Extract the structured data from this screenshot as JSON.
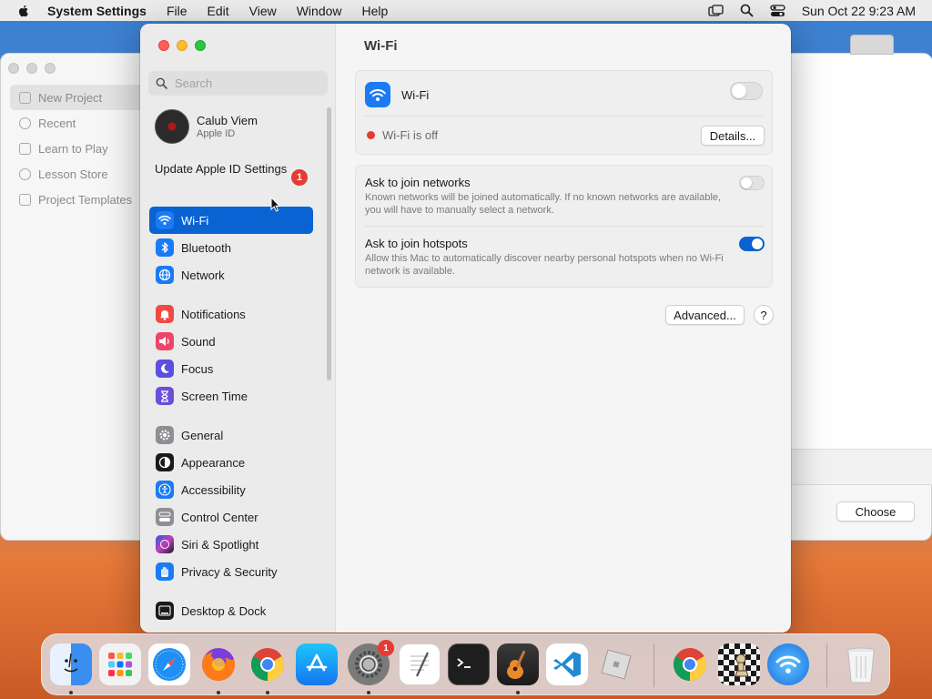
{
  "menubar": {
    "app_name": "System Settings",
    "menus": [
      "File",
      "Edit",
      "View",
      "Window",
      "Help"
    ],
    "clock": "Sun Oct 22  9:23 AM"
  },
  "background_app": {
    "sidebar_items": [
      "New Project",
      "Recent",
      "Learn to Play",
      "Lesson Store",
      "Project Templates"
    ],
    "choose_label": "Choose"
  },
  "settings": {
    "search": {
      "placeholder": "Search",
      "value": ""
    },
    "profile": {
      "name": "Calub Viem",
      "subtitle": "Apple ID"
    },
    "update": {
      "label": "Update Apple ID Settings",
      "badge": "1"
    },
    "nav": [
      {
        "label": "Wi-Fi",
        "icon": "wifi-icon",
        "color": "#1a7bf5",
        "active": true
      },
      {
        "label": "Bluetooth",
        "icon": "bluetooth-icon",
        "color": "#1a7bf5"
      },
      {
        "label": "Network",
        "icon": "globe-icon",
        "color": "#1a7bf5"
      },
      {
        "label": "Notifications",
        "icon": "bell-icon",
        "color": "#f04a45"
      },
      {
        "label": "Sound",
        "icon": "speaker-icon",
        "color": "#f0456a"
      },
      {
        "label": "Focus",
        "icon": "moon-icon",
        "color": "#5a4fe0"
      },
      {
        "label": "Screen Time",
        "icon": "hourglass-icon",
        "color": "#6a4fd8"
      },
      {
        "label": "General",
        "icon": "gear-icon",
        "color": "#8e8e93"
      },
      {
        "label": "Appearance",
        "icon": "appearance-icon",
        "color": "#1a1a1a"
      },
      {
        "label": "Accessibility",
        "icon": "accessibility-icon",
        "color": "#1a7bf5"
      },
      {
        "label": "Control Center",
        "icon": "control-center-icon",
        "color": "#8e8e93"
      },
      {
        "label": "Siri & Spotlight",
        "icon": "siri-icon",
        "color": "#c23fb8"
      },
      {
        "label": "Privacy & Security",
        "icon": "hand-icon",
        "color": "#1a7bf5"
      },
      {
        "label": "Desktop & Dock",
        "icon": "dock-icon",
        "color": "#1a1a1a"
      }
    ]
  },
  "content": {
    "title": "Wi-Fi",
    "wifi_label": "Wi-Fi",
    "wifi_on": false,
    "status_text": "Wi-Fi is off",
    "details_button": "Details...",
    "ask_networks": {
      "title": "Ask to join networks",
      "description": "Known networks will be joined automatically. If no known networks are available, you will have to manually select a network.",
      "on": false
    },
    "ask_hotspots": {
      "title": "Ask to join hotspots",
      "description": "Allow this Mac to automatically discover nearby personal hotspots when no Wi-Fi network is available.",
      "on": true
    },
    "advanced_button": "Advanced...",
    "help_button": "?"
  },
  "dock": {
    "apps": [
      {
        "name": "Finder",
        "icon": "finder-icon"
      },
      {
        "name": "Launchpad",
        "icon": "launchpad-icon"
      },
      {
        "name": "Safari",
        "icon": "safari-icon"
      },
      {
        "name": "Firefox",
        "icon": "firefox-icon"
      },
      {
        "name": "Chrome",
        "icon": "chrome-icon"
      },
      {
        "name": "App Store",
        "icon": "app-store-icon"
      },
      {
        "name": "System Settings",
        "icon": "settings-icon",
        "badge": "1"
      },
      {
        "name": "TextEdit",
        "icon": "textedit-icon"
      },
      {
        "name": "Terminal",
        "icon": "terminal-icon"
      },
      {
        "name": "GarageBand",
        "icon": "garageband-icon"
      },
      {
        "name": "VS Code",
        "icon": "vscode-icon"
      },
      {
        "name": "Roblox",
        "icon": "roblox-icon"
      },
      {
        "name": "Chrome",
        "icon": "chrome-icon"
      },
      {
        "name": "Chess",
        "icon": "chess-icon"
      },
      {
        "name": "Wireless Diagnostics",
        "icon": "wifi-app-icon"
      },
      {
        "name": "Trash",
        "icon": "trash-icon"
      }
    ]
  }
}
